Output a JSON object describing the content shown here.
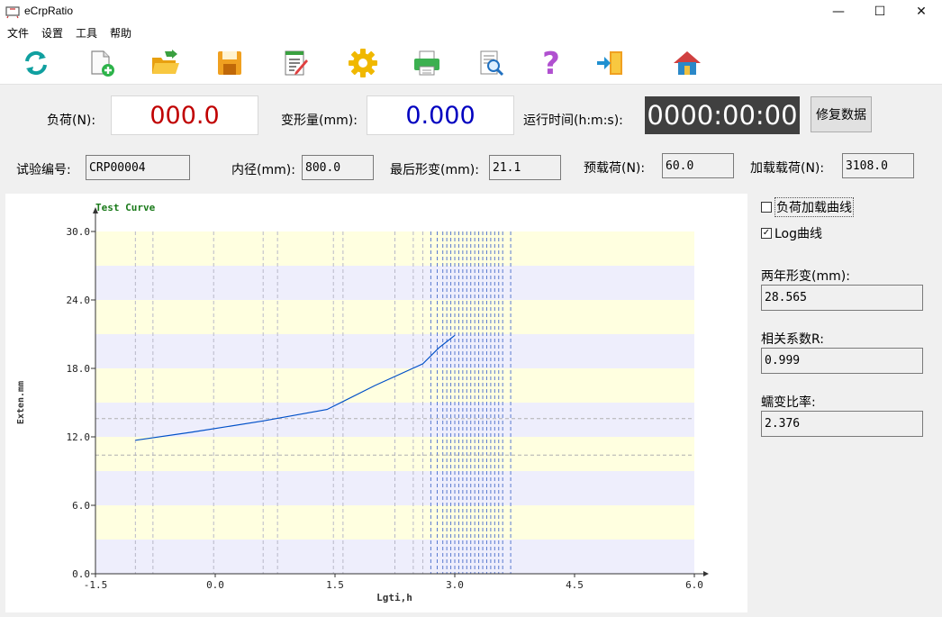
{
  "window": {
    "title": "eCrpRatio",
    "minimize": "—",
    "maximize": "☐",
    "close": "✕"
  },
  "menu": [
    "文件",
    "设置",
    "工具",
    "帮助"
  ],
  "toolbar": [
    {
      "name": "refresh-icon"
    },
    {
      "name": "new-file-icon"
    },
    {
      "name": "open-folder-icon"
    },
    {
      "name": "save-icon"
    },
    {
      "name": "edit-report-icon"
    },
    {
      "name": "settings-gear-icon"
    },
    {
      "name": "print-icon"
    },
    {
      "name": "print-preview-icon"
    },
    {
      "name": "help-icon"
    },
    {
      "name": "exit-icon"
    },
    {
      "name": "home-icon"
    }
  ],
  "readings": {
    "load_label": "负荷(N):",
    "load_value": "000.0",
    "load_color": "#c00000",
    "deform_label": "变形量(mm):",
    "deform_value": "0.000",
    "deform_color": "#0000c0",
    "runtime_label": "运行时间(h:m:s):",
    "runtime_value": "0000:00:00",
    "repair_button": "修复数据"
  },
  "params": {
    "test_no_label": "试验编号:",
    "test_no": "CRP00004",
    "inner_dia_label": "内径(mm):",
    "inner_dia": "800.0",
    "last_deform_label": "最后形变(mm):",
    "last_deform": "21.1",
    "preload_label": "预载荷(N):",
    "preload": "60.0",
    "load_label": "加载载荷(N):",
    "load": "3108.0"
  },
  "side": {
    "cb_load_curve": "负荷加载曲线",
    "cb_load_curve_checked": false,
    "cb_log_curve": "Log曲线",
    "cb_log_curve_checked": true,
    "two_year_label": "两年形变(mm):",
    "two_year_value": "28.565",
    "corr_label": "相关系数R:",
    "corr_value": "0.999",
    "creep_label": "蠕变比率:",
    "creep_value": "2.376"
  },
  "chart_data": {
    "type": "line",
    "title": "Test Curve",
    "xlabel": "Lgti,h",
    "ylabel": "Exten.mm",
    "xlim": [
      -1.5,
      6.0
    ],
    "ylim": [
      0.0,
      30.0
    ],
    "xticks": [
      "-1.5",
      "0.0",
      "1.5",
      "3.0",
      "4.5",
      "6.0"
    ],
    "yticks": [
      "0.0",
      "6.0",
      "12.0",
      "18.0",
      "24.0",
      "30.0"
    ],
    "series": [
      {
        "values": [
          [
            -1.0,
            11.7
          ],
          [
            -0.3,
            12.4
          ],
          [
            0.6,
            13.4
          ],
          [
            1.4,
            14.4
          ],
          [
            2.0,
            16.5
          ],
          [
            2.6,
            18.4
          ],
          [
            2.8,
            19.8
          ],
          [
            3.0,
            20.9
          ]
        ]
      }
    ],
    "vlines": [
      -1.0,
      -0.78,
      -0.02,
      0.6,
      0.78,
      1.48,
      1.6,
      2.25,
      2.48,
      2.6,
      2.7,
      2.78,
      2.85,
      2.9,
      2.95,
      3.0,
      3.05,
      3.1,
      3.15,
      3.2,
      3.25,
      3.3,
      3.35,
      3.4,
      3.45,
      3.5,
      3.55,
      3.6,
      3.7
    ],
    "hlines": [
      13.6,
      10.4
    ],
    "band_colors": [
      "#ffffe0",
      "#eeeefc"
    ],
    "line_color": "#0050c8"
  }
}
